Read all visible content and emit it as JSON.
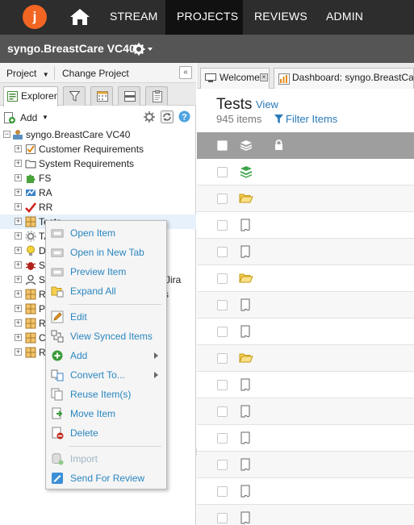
{
  "nav": {
    "logo_letter": "j",
    "links": [
      {
        "label": "STREAM",
        "active": false
      },
      {
        "label": "PROJECTS",
        "active": true
      },
      {
        "label": "REVIEWS",
        "active": false
      },
      {
        "label": "ADMIN",
        "active": false
      }
    ]
  },
  "project": {
    "title": "syngo.BreastCare VC40"
  },
  "left": {
    "menu": {
      "project": "Project",
      "change": "Change Project"
    },
    "tabs": {
      "explorer": "Explorer"
    },
    "toolbar": {
      "add": "Add"
    },
    "tree": {
      "root": "syngo.BreastCare VC40",
      "items": [
        "Customer Requirements",
        "System Requirements",
        "FS",
        "RA",
        "RR",
        "Tests",
        "TA",
        "D",
        "S",
        "S",
        "R",
        "P",
        "R",
        "C",
        "R"
      ],
      "obscured_tail": {
        "jira": "Jira",
        "s": "s"
      }
    }
  },
  "right": {
    "tabs": [
      "Welcome",
      "Dashboard: syngo.BreastCare"
    ],
    "title": "Tests",
    "view_link": "View",
    "count": "945 items",
    "filter": "Filter Items",
    "rows": [
      "status",
      "folder",
      "doc",
      "doc",
      "folder",
      "doc",
      "doc",
      "folder",
      "doc",
      "doc",
      "doc",
      "doc",
      "doc",
      "doc"
    ]
  },
  "context_menu": {
    "items": [
      {
        "label": "Open Item",
        "icon": "open-icon",
        "disabled": false,
        "submenu": false
      },
      {
        "label": "Open in New Tab",
        "icon": "new-tab-icon",
        "disabled": false,
        "submenu": false
      },
      {
        "label": "Preview Item",
        "icon": "preview-icon",
        "disabled": false,
        "submenu": false
      },
      {
        "label": "Expand All",
        "icon": "expand-folder-icon",
        "disabled": false,
        "submenu": false
      },
      {
        "label": "Edit",
        "icon": "pencil-icon",
        "disabled": false,
        "submenu": false
      },
      {
        "label": "View Synced Items",
        "icon": "synced-icon",
        "disabled": false,
        "submenu": false
      },
      {
        "label": "Add",
        "icon": "add-icon",
        "disabled": false,
        "submenu": true
      },
      {
        "label": "Convert To...",
        "icon": "convert-icon",
        "disabled": false,
        "submenu": true
      },
      {
        "label": "Reuse Item(s)",
        "icon": "reuse-icon",
        "disabled": false,
        "submenu": false
      },
      {
        "label": "Move Item",
        "icon": "move-icon",
        "disabled": false,
        "submenu": false
      },
      {
        "label": "Delete",
        "icon": "delete-icon",
        "disabled": false,
        "submenu": false
      },
      {
        "label": "Import",
        "icon": "import-icon",
        "disabled": true,
        "submenu": false
      },
      {
        "label": "Send For Review",
        "icon": "review-icon",
        "disabled": false,
        "submenu": false
      }
    ]
  }
}
